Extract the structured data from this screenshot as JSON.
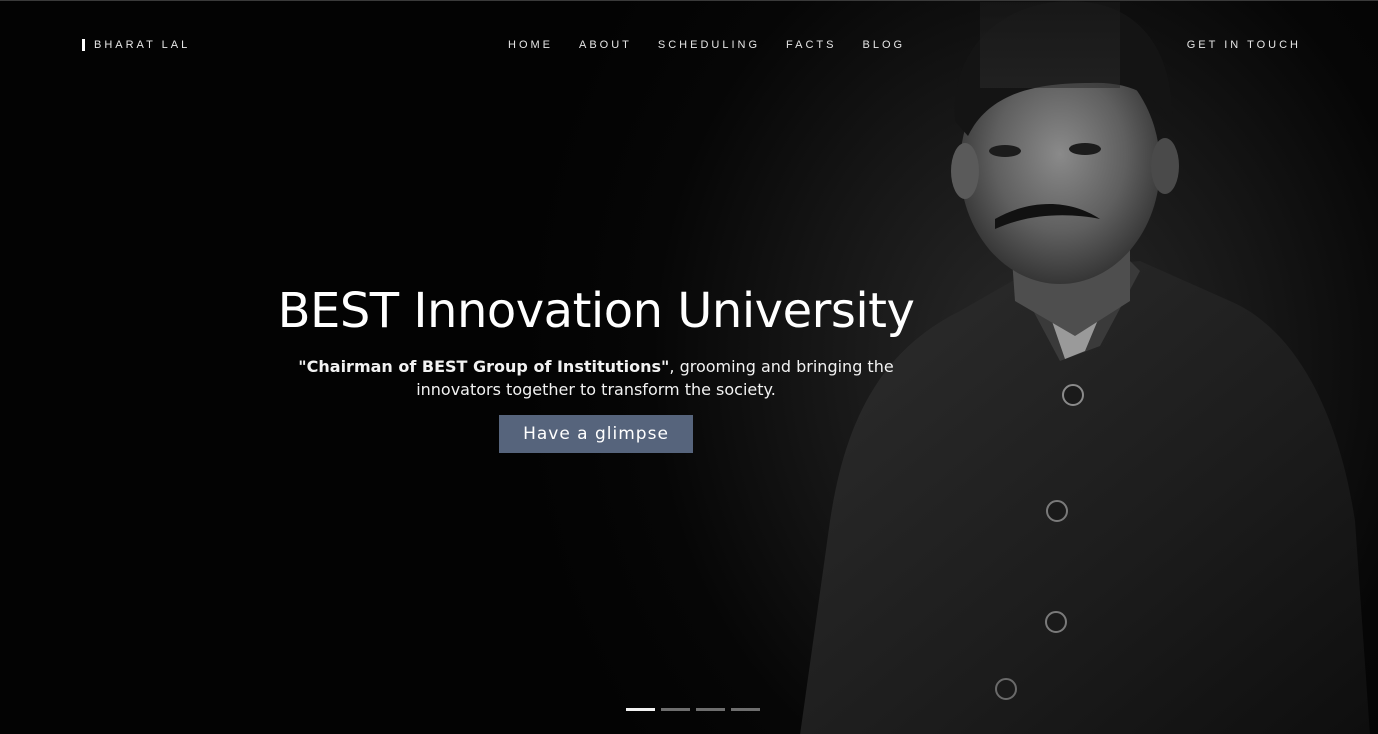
{
  "nav": {
    "brand": "BHARAT LAL",
    "items": [
      {
        "label": "HOME"
      },
      {
        "label": "ABOUT"
      },
      {
        "label": "SCHEDULING"
      },
      {
        "label": "FACTS"
      },
      {
        "label": "BLOG"
      }
    ],
    "cta": "GET IN TOUCH"
  },
  "hero": {
    "title": "BEST Innovation University",
    "subtitle_bold": "\"Chairman of BEST Group of Institutions\"",
    "subtitle_rest": ", grooming and bringing the innovators together to transform the society.",
    "button": "Have a glimpse"
  },
  "slider": {
    "count": 4,
    "active_index": 0
  },
  "colors": {
    "background": "#000000",
    "button": "#56647c",
    "dot_active": "#f2f2f2",
    "dot_inactive": "#6e6e6e"
  }
}
